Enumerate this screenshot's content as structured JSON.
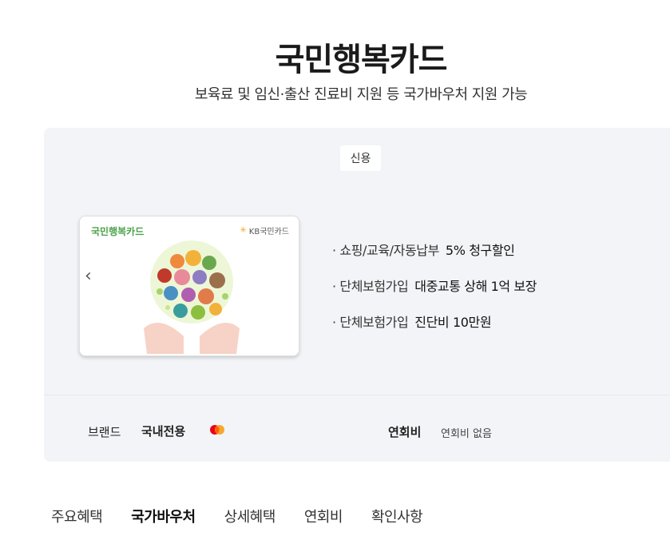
{
  "header": {
    "title": "국민행복카드",
    "subtitle": "보육료 및 임신·출산 진료비 지원 등 국가바우처 지원 가능"
  },
  "card": {
    "type_badge": "신용",
    "face_name": "국민행복카드",
    "face_issuer": "KB국민카드",
    "prev_arrow": "‹"
  },
  "benefits": [
    {
      "category": "· 쇼핑/교육/자동납부",
      "value": "5% 청구할인"
    },
    {
      "category": "· 단체보험가입",
      "value": "대중교통 상해 1억 보장"
    },
    {
      "category": "· 단체보험가입",
      "value": "진단비 10만원"
    }
  ],
  "info": {
    "brand_label": "브랜드",
    "brand_value": "국내전용",
    "brand_icon": "mastercard-icon",
    "fee_label": "연회비",
    "fee_value": "연회비 없음"
  },
  "tabs": [
    "주요혜택",
    "국가바우처",
    "상세혜택",
    "연회비",
    "확인사항"
  ],
  "active_tab": "국가바우처",
  "colors": {
    "panel_bg": "#f2f4f7",
    "card_green": "#4aa24a",
    "kb_yellow": "#f5a623"
  }
}
